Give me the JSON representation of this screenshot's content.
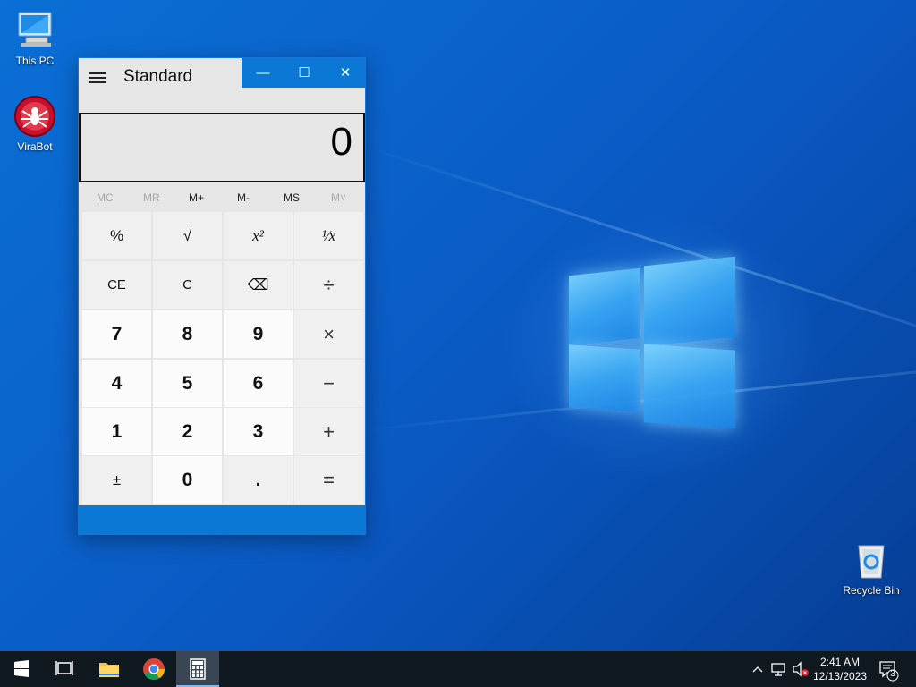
{
  "desktop": {
    "icons": [
      {
        "label": "This PC",
        "icon": "this-pc-icon"
      },
      {
        "label": "ViraBot",
        "icon": "virabot-icon"
      },
      {
        "label": "Recycle Bin",
        "icon": "recycle-bin-icon"
      }
    ]
  },
  "calculator": {
    "mode": "Standard",
    "display": "0",
    "window_controls": {
      "minimize": "—",
      "maximize": "☐",
      "close": "✕"
    },
    "memory": [
      {
        "label": "MC",
        "enabled": false
      },
      {
        "label": "MR",
        "enabled": false
      },
      {
        "label": "M+",
        "enabled": true
      },
      {
        "label": "M-",
        "enabled": true
      },
      {
        "label": "MS",
        "enabled": true
      },
      {
        "label": "M˅",
        "enabled": false
      }
    ],
    "keys": [
      [
        "%",
        "√",
        "x²",
        "¹⁄x"
      ],
      [
        "CE",
        "C",
        "⌫",
        "÷"
      ],
      [
        "7",
        "8",
        "9",
        "×"
      ],
      [
        "4",
        "5",
        "6",
        "−"
      ],
      [
        "1",
        "2",
        "3",
        "+"
      ],
      [
        "±",
        "0",
        ".",
        "="
      ]
    ]
  },
  "taskbar": {
    "time": "2:41 AM",
    "date": "12/13/2023",
    "notification_count": "3",
    "accent": "#0b78d6"
  }
}
